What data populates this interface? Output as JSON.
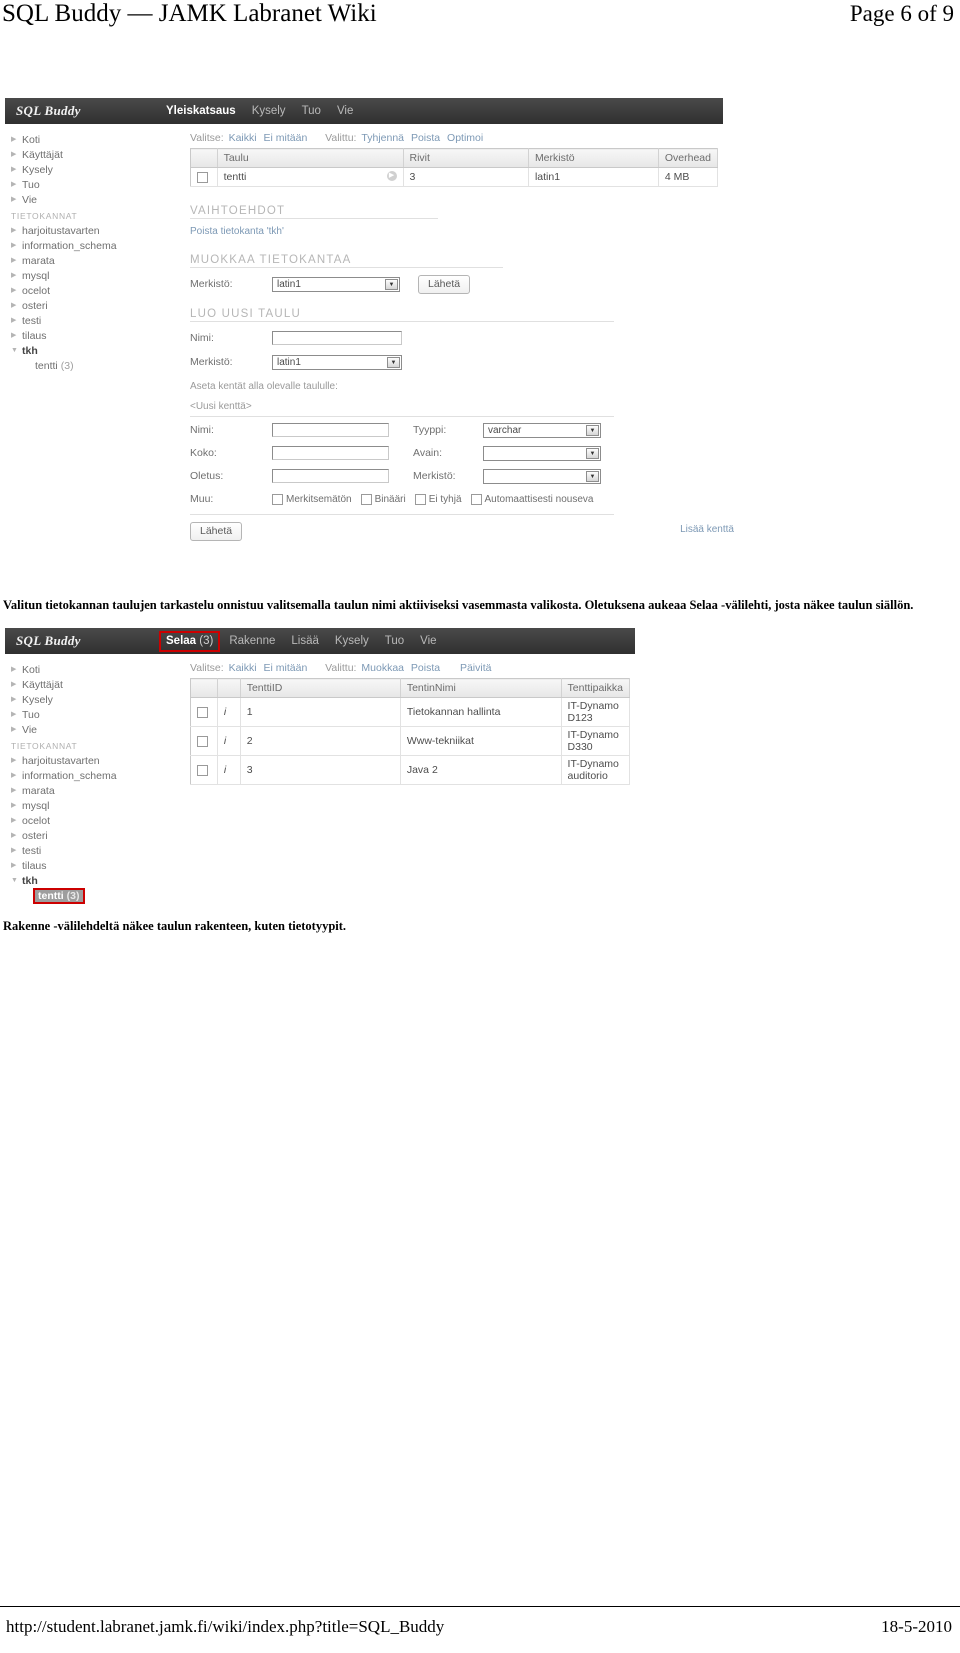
{
  "header": {
    "title": "SQL Buddy — JAMK Labranet Wiki",
    "page_indicator": "Page 6 of 9"
  },
  "footer": {
    "url": "http://student.labranet.jamk.fi/wiki/index.php?title=SQL_Buddy",
    "date": "18-5-2010"
  },
  "screenshot1": {
    "brand": "SQL Buddy",
    "nav": [
      {
        "label": "Yleiskatsaus",
        "active": true
      },
      {
        "label": "Kysely",
        "active": false
      },
      {
        "label": "Tuo",
        "active": false
      },
      {
        "label": "Vie",
        "active": false
      }
    ],
    "sidebar": {
      "top_items": [
        "Koti",
        "Käyttäjät",
        "Kysely",
        "Tuo",
        "Vie"
      ],
      "section_label": "TIETOKANNAT",
      "databases": [
        "harjoitustavarten",
        "information_schema",
        "marata",
        "mysql",
        "ocelot",
        "osteri",
        "testi",
        "tilaus"
      ],
      "open_database": "tkh",
      "tables": [
        {
          "name": "tentti",
          "count": "(3)"
        }
      ]
    },
    "actionbar": {
      "select_label": "Valitse:",
      "select_links": [
        "Kaikki",
        "Ei mitään"
      ],
      "selected_label": "Valittu:",
      "selected_links": [
        "Tyhjennä",
        "Poista",
        "Optimoi"
      ]
    },
    "table": {
      "columns": [
        "Taulu",
        "Rivit",
        "Merkistö",
        "Overhead"
      ],
      "rows": [
        {
          "taulu": "tentti",
          "rivit": "3",
          "merkisto": "latin1",
          "overhead": "4 MB"
        }
      ]
    },
    "options_section": {
      "title": "VAIHTOEHDOT",
      "drop_link": "Poista tietokanta 'tkh'"
    },
    "edit_db_section": {
      "title": "MUOKKAA TIETOKANTAA",
      "charset_label": "Merkistö:",
      "charset_value": "latin1",
      "submit_label": "Lähetä"
    },
    "create_table_section": {
      "title": "LUO UUSI TAULU",
      "name_label": "Nimi:",
      "name_value": "",
      "charset_label": "Merkistö:",
      "charset_value": "latin1",
      "fields_hint": "Aseta kentät alla olevalle taululle:",
      "new_field_label": "<Uusi kenttä>",
      "field": {
        "name_label": "Nimi:",
        "name_value": "",
        "type_label": "Tyyppi:",
        "type_value": "varchar",
        "size_label": "Koko:",
        "size_value": "",
        "key_label": "Avain:",
        "key_value": "",
        "default_label": "Oletus:",
        "default_value": "",
        "charset_label": "Merkistö:",
        "charset_value": "",
        "other_label": "Muu:",
        "checkboxes": [
          "Merkitsemätön",
          "Binääri",
          "Ei tyhjä",
          "Automaattisesti nouseva"
        ]
      },
      "submit_label": "Lähetä",
      "add_field_link": "Lisää kenttä"
    }
  },
  "caption1": "Valitun tietokannan taulujen tarkastelu onnistuu valitsemalla taulun nimi aktiiviseksi vasemmasta valikosta. Oletuksena aukeaa Selaa -välilehti, josta näkee taulun siällön.",
  "screenshot2": {
    "brand": "SQL Buddy",
    "nav": [
      {
        "label": "Selaa",
        "count": "(3)",
        "active": true,
        "boxed": true
      },
      {
        "label": "Rakenne",
        "active": false
      },
      {
        "label": "Lisää",
        "active": false
      },
      {
        "label": "Kysely",
        "active": false
      },
      {
        "label": "Tuo",
        "active": false
      },
      {
        "label": "Vie",
        "active": false
      }
    ],
    "sidebar": {
      "top_items": [
        "Koti",
        "Käyttäjät",
        "Kysely",
        "Tuo",
        "Vie"
      ],
      "section_label": "TIETOKANNAT",
      "databases": [
        "harjoitustavarten",
        "information_schema",
        "marata",
        "mysql",
        "ocelot",
        "osteri",
        "testi",
        "tilaus"
      ],
      "open_database": "tkh",
      "tables": [
        {
          "name": "tentti",
          "count": "(3)",
          "selected": true
        }
      ]
    },
    "actionbar": {
      "select_label": "Valitse:",
      "select_links": [
        "Kaikki",
        "Ei mitään"
      ],
      "selected_label": "Valittu:",
      "selected_links": [
        "Muokkaa",
        "Poista"
      ],
      "refresh_link": "Päivitä"
    },
    "table": {
      "columns": [
        "TenttiID",
        "TentinNimi",
        "Tenttipaikka"
      ],
      "rows": [
        {
          "id": "1",
          "nimi": "Tietokannan hallinta",
          "paikka": "IT-Dynamo D123"
        },
        {
          "id": "2",
          "nimi": "Www-tekniikat",
          "paikka": "IT-Dynamo D330"
        },
        {
          "id": "3",
          "nimi": "Java 2",
          "paikka": "IT-Dynamo auditorio"
        }
      ]
    }
  },
  "caption2": "Rakenne -välilehdeltä näkee taulun rakenteen, kuten tietotyypit."
}
